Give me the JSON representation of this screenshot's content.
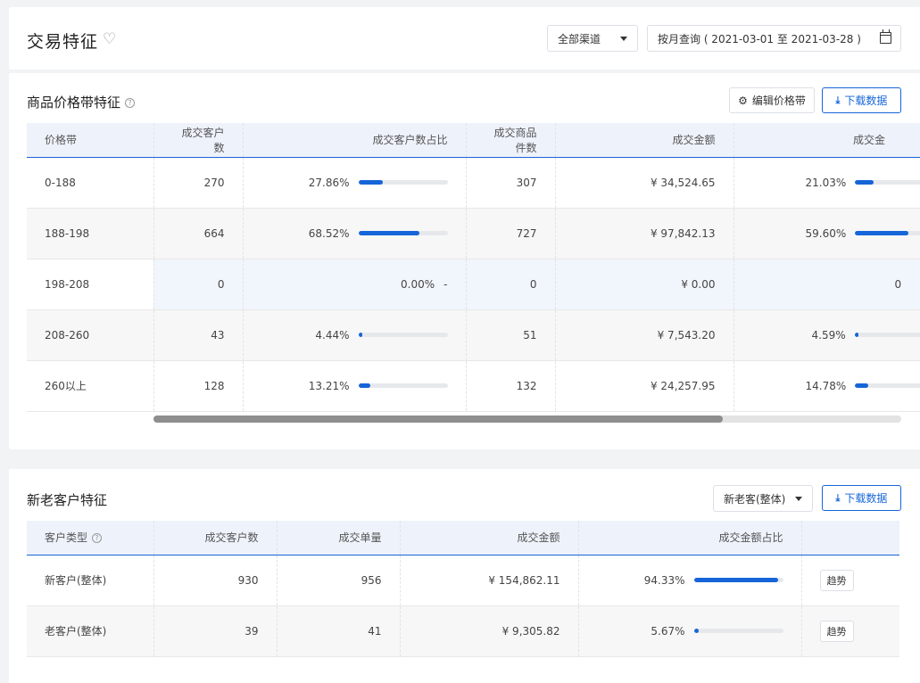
{
  "header": {
    "title": "交易特征",
    "channel_select": "全部渠道",
    "date_range": "按月查询 ( 2021-03-01 至 2021-03-28 )"
  },
  "price_band": {
    "title": "商品价格带特征",
    "edit_button": "编辑价格带",
    "download_button": "下载数据",
    "columns": [
      "价格带",
      "成交客户数",
      "成交客户数占比",
      "成交商品件数",
      "成交金额",
      "成交金"
    ],
    "rows": [
      {
        "band": "0-188",
        "customers": "270",
        "customer_pct": "27.86%",
        "customer_pct_value": 27.86,
        "items": "307",
        "amount": "¥ 34,524.65",
        "amount_pct": "21.03%",
        "amount_pct_value": 21.03
      },
      {
        "band": "188-198",
        "customers": "664",
        "customer_pct": "68.52%",
        "customer_pct_value": 68.52,
        "items": "727",
        "amount": "¥ 97,842.13",
        "amount_pct": "59.60%",
        "amount_pct_value": 59.6
      },
      {
        "band": "198-208",
        "customers": "0",
        "customer_pct": "0.00%",
        "customer_pct_dash": "-",
        "items": "0",
        "amount": "¥ 0.00",
        "amount_pct": "0"
      },
      {
        "band": "208-260",
        "customers": "43",
        "customer_pct": "4.44%",
        "customer_pct_value": 4.44,
        "items": "51",
        "amount": "¥ 7,543.20",
        "amount_pct": "4.59%",
        "amount_pct_value": 4.59
      },
      {
        "band": "260以上",
        "customers": "128",
        "customer_pct": "13.21%",
        "customer_pct_value": 13.21,
        "items": "132",
        "amount": "¥ 24,257.95",
        "amount_pct": "14.78%",
        "amount_pct_value": 14.78
      }
    ]
  },
  "customers": {
    "title": "新老客户特征",
    "type_select": "新老客(整体)",
    "download_button": "下载数据",
    "columns": [
      "客户类型",
      "成交客户数",
      "成交单量",
      "成交金额",
      "成交金额占比",
      ""
    ],
    "rows": [
      {
        "type": "新客户(整体)",
        "customers": "930",
        "orders": "956",
        "amount": "¥ 154,862.11",
        "amount_pct": "94.33%",
        "amount_pct_value": 94.33,
        "trend": "趋势"
      },
      {
        "type": "老客户(整体)",
        "customers": "39",
        "orders": "41",
        "amount": "¥ 9,305.82",
        "amount_pct": "5.67%",
        "amount_pct_value": 5.67,
        "trend": "趋势"
      }
    ]
  },
  "colors": {
    "accent": "#1565d8",
    "track": "#e6e8ec"
  },
  "icons": [
    "heart-icon",
    "help-icon",
    "calendar-icon",
    "gear-icon",
    "download-icon",
    "caret-down-icon"
  ]
}
